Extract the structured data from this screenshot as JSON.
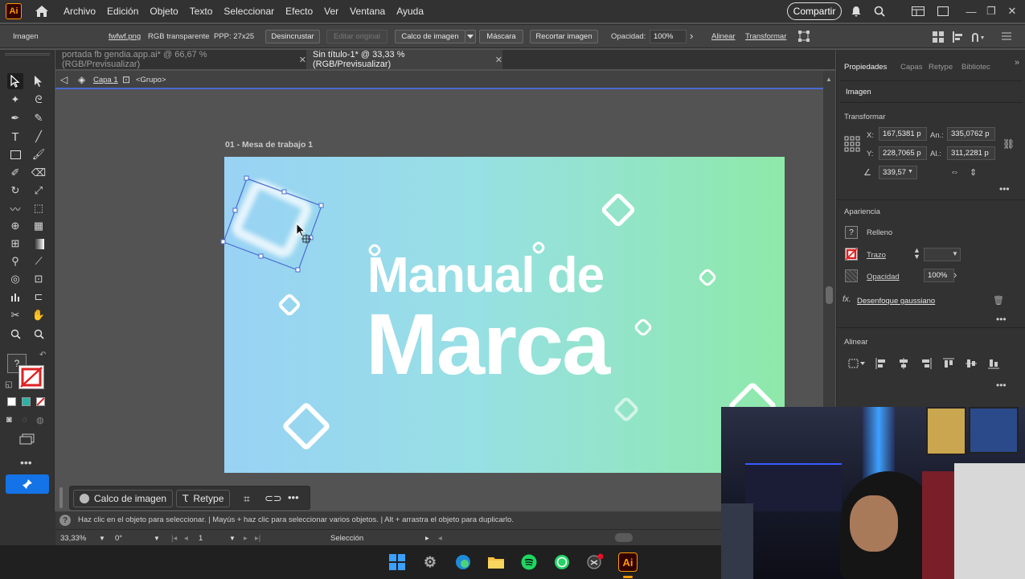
{
  "app": {
    "logo": "Ai",
    "share_label": "Compartir"
  },
  "menu": [
    "Archivo",
    "Edición",
    "Objeto",
    "Texto",
    "Seleccionar",
    "Efecto",
    "Ver",
    "Ventana",
    "Ayuda"
  ],
  "control": {
    "object_type": "Imagen",
    "filename": "fwfwf.png",
    "color_mode": "RGB transparente",
    "ppp": "PPP: 27x25",
    "unembed": "Desincrustar",
    "edit_original": "Editar original",
    "image_trace": "Calco de imagen",
    "mask": "Máscara",
    "crop": "Recortar imagen",
    "opacity_label": "Opacidad:",
    "opacity_value": "100%",
    "align": "Alinear",
    "transform": "Transformar"
  },
  "tabs": [
    {
      "label": "portada fb gendia.app.ai* @ 66,67 % (RGB/Previsualizar)",
      "active": false
    },
    {
      "label": "Sin título-1* @ 33,33 % (RGB/Previsualizar)",
      "active": true
    }
  ],
  "breadcrumb": {
    "layer": "Capa 1",
    "group": "<Grupo>"
  },
  "artboard": {
    "label": "01 - Mesa de trabajo 1",
    "line1": "Manual de",
    "line2": "Marca"
  },
  "floatbar": {
    "trace": "Calco de imagen",
    "retype": "Retype"
  },
  "hint": "Haz clic en el objeto para seleccionar.  |  Mayús + haz clic para seleccionar varios objetos.  |  Alt + arrastra el objeto para duplicarlo.",
  "status": {
    "zoom": "33,33%",
    "rotation": "0°",
    "artboard_num": "1",
    "tool": "Selección"
  },
  "panel": {
    "tabs": [
      "Propiedades",
      "Capas",
      "Retype",
      "Bibliotec"
    ],
    "object": "Imagen",
    "transform_title": "Transformar",
    "x_label": "X:",
    "x_value": "167,5381 p",
    "y_label": "Y:",
    "y_value": "228,7065 p",
    "w_label": "An.:",
    "w_value": "335,0762 p",
    "h_label": "Al.:",
    "h_value": "311,2281 p",
    "angle_value": "339,57",
    "appearance_title": "Apariencia",
    "fill": "Relleno",
    "stroke": "Trazo",
    "opacity": "Opacidad",
    "opacity_value": "100%",
    "effect": "Desenfoque gaussiano",
    "align_title": "Alinear"
  },
  "colors": {
    "accent": "#4a6bd1",
    "artboard_start": "#99d2f5",
    "artboard_end": "#8ee9a9",
    "ai_orange": "#ff9a00"
  }
}
